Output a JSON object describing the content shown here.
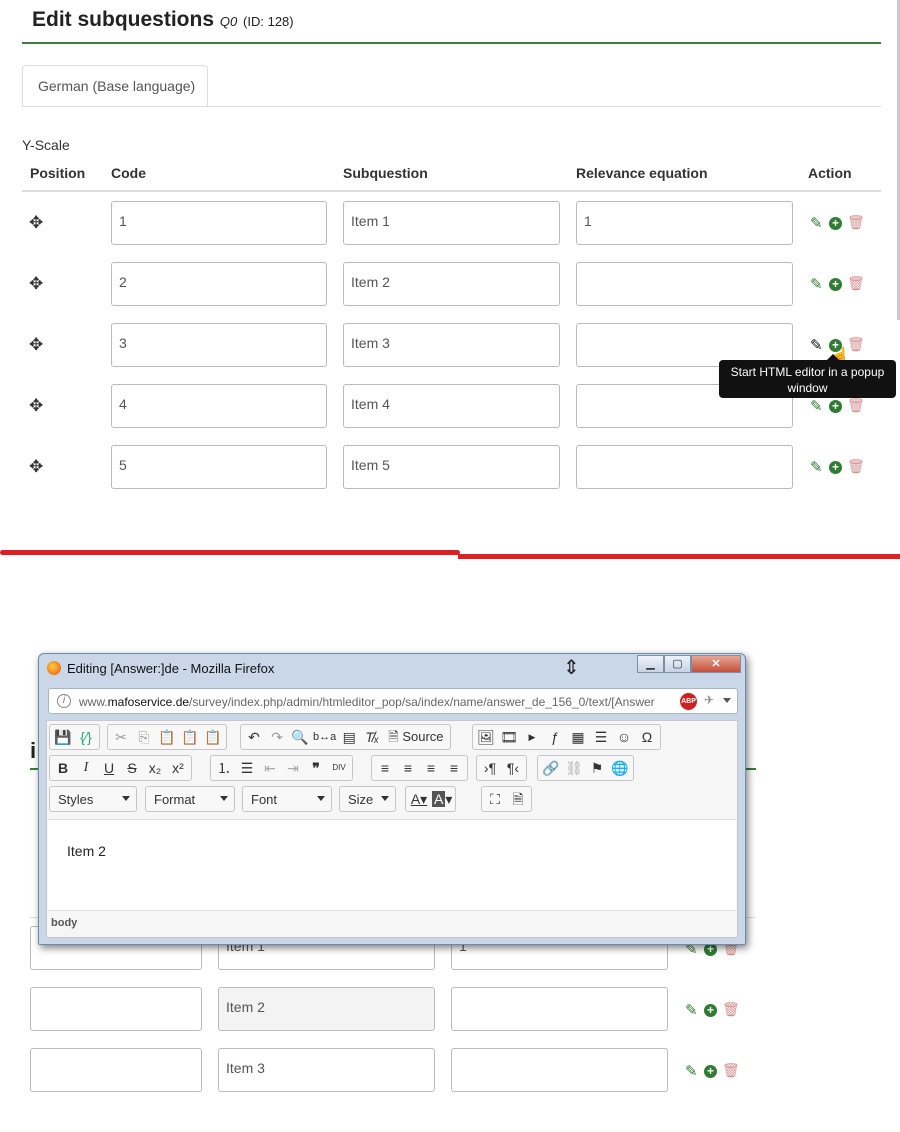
{
  "header": {
    "title": "Edit subquestions",
    "code": "Q0",
    "id_text": "(ID: 128)"
  },
  "tabs": [
    {
      "label": "German (Base language)"
    }
  ],
  "scale_label": "Y-Scale",
  "columns": {
    "position": "Position",
    "code": "Code",
    "subquestion": "Subquestion",
    "relevance": "Relevance equation",
    "action": "Action"
  },
  "rows": [
    {
      "code": "1",
      "subquestion": "Item 1",
      "relevance": "1"
    },
    {
      "code": "2",
      "subquestion": "Item 2",
      "relevance": ""
    },
    {
      "code": "3",
      "subquestion": "Item 3",
      "relevance": ""
    },
    {
      "code": "4",
      "subquestion": "Item 4",
      "relevance": ""
    },
    {
      "code": "5",
      "subquestion": "Item 5",
      "relevance": ""
    }
  ],
  "tooltip": "Start HTML editor in a popup window",
  "popup": {
    "window_title": "Editing [Answer:]de - Mozilla Firefox",
    "url_prefix": "www.",
    "url_domain": "mafoservice.de",
    "url_path": "/survey/index.php/admin/htmleditor_pop/sa/index/name/answer_de_156_0/text/[Answer",
    "abp_label": "ABP",
    "source_label": "Source",
    "combos": {
      "styles": "Styles",
      "format": "Format",
      "font": "Font",
      "size": "Size"
    },
    "content": "Item 2",
    "status_path": "body"
  },
  "background_rows": [
    {
      "subquestion": "Item 1",
      "relevance": "1"
    },
    {
      "subquestion": "Item 2",
      "relevance": ""
    },
    {
      "subquestion": "Item 3",
      "relevance": ""
    }
  ],
  "colors": {
    "accent_green": "#3c7d3c",
    "action_green": "#2e7d32",
    "delete_red": "#d98c8c",
    "divider_red": "#e02020"
  }
}
